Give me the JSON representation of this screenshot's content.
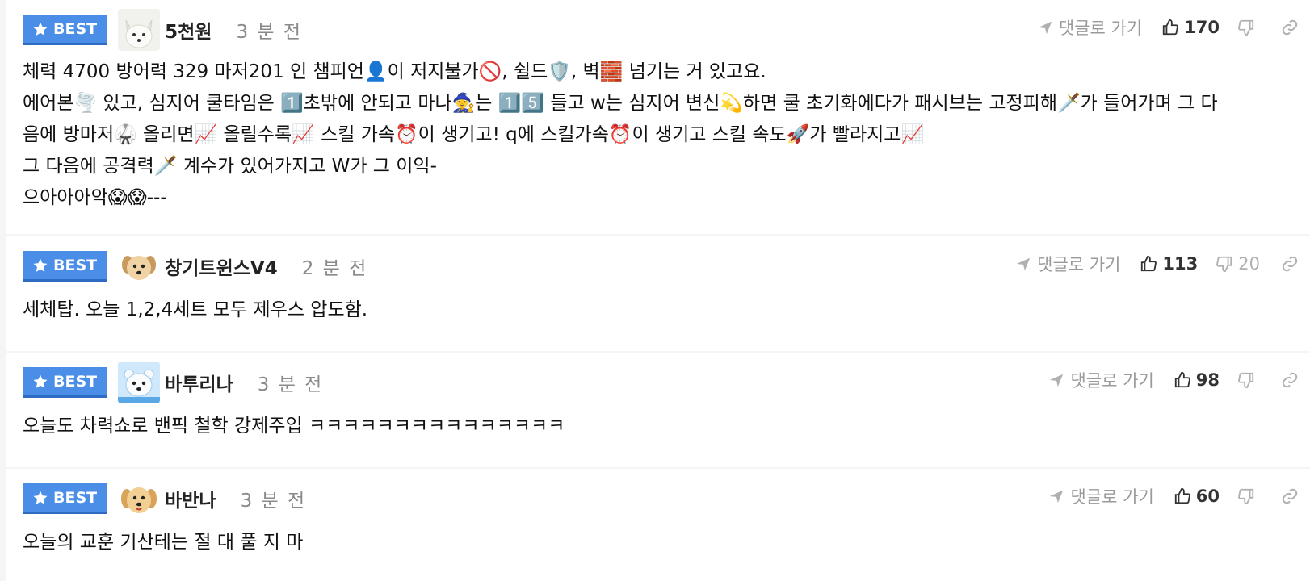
{
  "badge_label": "BEST",
  "reply_label": "댓글로 가기",
  "colors": {
    "badge": "#4a8ee8",
    "background": "#f5f5f5"
  },
  "comments": [
    {
      "nickname": "5천원",
      "time": "3 분 전",
      "avatar": "white-fox-avatar",
      "likes": "170",
      "dislikes": "",
      "lines": [
        "체력 4700 방어력 329 마저201 인 챔피언👤이 저지불가🚫, 쉴드🛡️, 벽🧱 넘기는 거 있고요.",
        "에어본🌪️ 있고, 심지어 쿨타임은 1️⃣초밖에 안되고 마나🧙는 1️⃣5️⃣ 들고 w는 심지어 변신💫하면 쿨 초기화에다가 패시브는 고정피해🗡️가 들어가며 그 다",
        "음에 방마저🥋 올리면📈 올릴수록📈 스킬 가속⏰이 생기고! q에 스킬가속⏰이 생기고 스킬 속도🚀가 빨라지고📈",
        "그 다음에 공격력🗡️ 계수가 있어가지고 W가 그 이익-",
        "으아아아악😱😱---"
      ]
    },
    {
      "nickname": "창기트윈스V4",
      "time": "2 분 전",
      "avatar": "puppy-avatar",
      "likes": "113",
      "dislikes": "20",
      "lines": [
        "세체탑. 오늘 1,2,4세트 모두 제우스 압도함."
      ]
    },
    {
      "nickname": "바투리나",
      "time": "3 분 전",
      "avatar": "polar-bear-avatar",
      "likes": "98",
      "dislikes": "",
      "lines": [
        "오늘도 차력쇼로 밴픽 철학 강제주입 ㅋㅋㅋㅋㅋㅋㅋㅋㅋㅋㅋㅋㅋㅋㅋ"
      ]
    },
    {
      "nickname": "바반나",
      "time": "3 분 전",
      "avatar": "golden-puppy-avatar",
      "likes": "60",
      "dislikes": "",
      "lines": [
        "오늘의 교훈 기산테는 절 대 풀 지 마"
      ]
    }
  ]
}
